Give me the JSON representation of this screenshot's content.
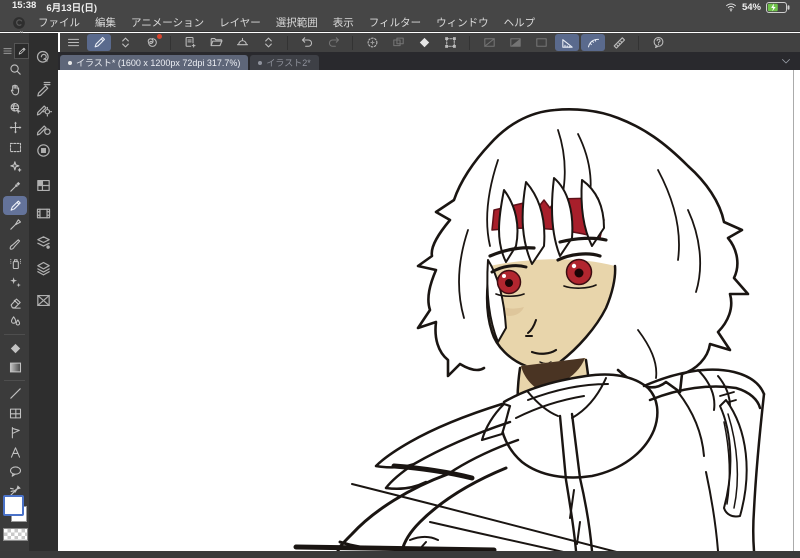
{
  "status_bar": {
    "time": "15:38",
    "date": "6月13日(日)",
    "battery": "54%",
    "battery_color": "#6fc24a",
    "icons": [
      "wifi-icon",
      "battery-charging-icon"
    ]
  },
  "menu_bar": {
    "logo_icon": "clip-studio-logo",
    "items": [
      "ファイル",
      "編集",
      "アニメーション",
      "レイヤー",
      "選択範囲",
      "表示",
      "フィルター",
      "ウィンドウ",
      "ヘルプ"
    ]
  },
  "toolbar": {
    "panel_controls": [
      "collapse-left-icon",
      "panel-handle-icon",
      "collapse-left-icon",
      "expand-right-icon"
    ],
    "buttons": [
      {
        "icon": "main-menu-icon",
        "state": "normal"
      },
      {
        "icon": "pen-settings-icon",
        "state": "selected"
      },
      {
        "icon": "workspace-chevrons-icon",
        "state": "normal"
      },
      {
        "icon": "clip-studio-icon",
        "state": "normal",
        "badge": true
      },
      {
        "icon": "new-canvas-icon",
        "state": "normal"
      },
      {
        "icon": "open-file-icon",
        "state": "normal"
      },
      {
        "icon": "save-icon",
        "state": "normal"
      },
      {
        "icon": "save-chevrons-icon",
        "state": "normal"
      },
      {
        "icon": "undo-icon",
        "state": "normal"
      },
      {
        "icon": "redo-icon",
        "state": "disabled"
      },
      {
        "icon": "filter-sparkle-icon",
        "state": "normal"
      },
      {
        "icon": "select-layer-icon",
        "state": "disabled"
      },
      {
        "icon": "fill-icon",
        "state": "normal"
      },
      {
        "icon": "transform-icon",
        "state": "normal"
      },
      {
        "icon": "deselect-icon",
        "state": "disabled"
      },
      {
        "icon": "invert-selection-icon",
        "state": "disabled"
      },
      {
        "icon": "selection-area-icon",
        "state": "disabled"
      },
      {
        "icon": "snap-ruler-icon",
        "state": "selected"
      },
      {
        "icon": "snap-curve-ruler-icon",
        "state": "selected"
      },
      {
        "icon": "snap-special-ruler-icon",
        "state": "normal"
      },
      {
        "icon": "help-icon",
        "state": "normal"
      }
    ]
  },
  "tab_bar": {
    "search_icon": "quick-access-loupe-icon",
    "tabs": [
      {
        "label": "イラスト* (1600 x 1200px 72dpi 317.7%)",
        "active": true
      },
      {
        "label": "イラスト2*",
        "active": false
      }
    ],
    "overflow_icon": "chevron-down-icon"
  },
  "tool_palette": {
    "header_icons": [
      "palette-menu-icon",
      "current-tool-icon"
    ],
    "tools": [
      "zoom-tool",
      "hand-tool",
      "operation-tool",
      "move-layer-tool",
      "selection-tool",
      "auto-select-tool",
      "eyedropper-tool",
      "pen-tool",
      "pencil-tool",
      "brush-tool",
      "airbrush-tool",
      "decoration-tool",
      "eraser-tool",
      "blend-tool",
      "fill-tool",
      "gradient-tool",
      "figure-tool",
      "frame-border-tool",
      "flow-line-tool",
      "text-tool",
      "balloon-tool",
      "line-correction-tool"
    ],
    "selected_tool": "pen-tool",
    "main_color": "#ffffff",
    "sub_color": "#ffffff",
    "transparent_swatch": "checkered"
  },
  "panel_rail": {
    "icons": [
      "quick-access-icon",
      "sub-tool-icon",
      "tool-property-icon",
      "brush-size-icon",
      "color-set-icon",
      "animation-cels-icon",
      "timeline-icon",
      "layer-property-icon",
      "layer-icon",
      "navigator-icon"
    ]
  },
  "canvas": {
    "document_title": "イラスト",
    "document_size": "1600 x 1200px",
    "dpi": "72dpi",
    "zoom": "317.7%",
    "artwork": {
      "subject": "white-haired anime character sketch with red headband",
      "line_color": "#1a1512",
      "hair_color": "#ffffff",
      "skin_color": "#e8d5ab",
      "skin_shade_color": "#d9bf92",
      "headband_color": "#a81f2b",
      "eye_color": "#b2262f",
      "shadow_color": "#4a3423"
    }
  }
}
